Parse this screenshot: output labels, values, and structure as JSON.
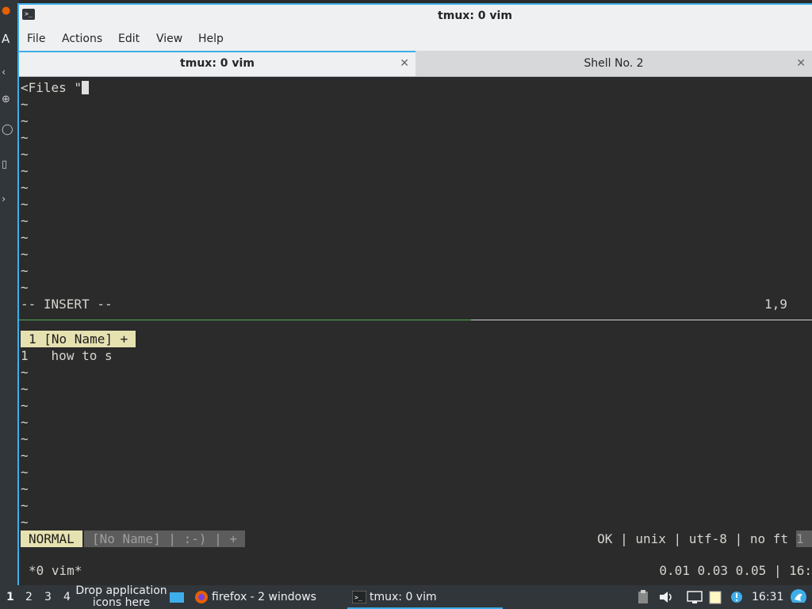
{
  "window": {
    "title": "tmux: 0 vim",
    "menu": [
      "File",
      "Actions",
      "Edit",
      "View",
      "Help"
    ]
  },
  "tabs": [
    {
      "label": "tmux: 0 vim",
      "active": true
    },
    {
      "label": "Shell No. 2",
      "active": false
    }
  ],
  "top_pane": {
    "first_line": "<Files \"",
    "tilde": "~",
    "mode_line": "-- INSERT --",
    "cursor_pos": "1,9"
  },
  "bottom_pane": {
    "tabline": "1 [No Name] +",
    "line_number": "1",
    "line_text": "how to s",
    "tilde": "~",
    "status": {
      "mode": "NORMAL",
      "middle": "[No Name] | :-) | +",
      "right": "OK | unix | utf-8 | no ft",
      "end": "1"
    }
  },
  "tmux": {
    "left": "*0 vim*",
    "right": "0.01 0.03 0.05 | 16:"
  },
  "taskbar": {
    "workspaces": [
      "1",
      "2",
      "3",
      "4"
    ],
    "drop_text": "Drop application icons here",
    "tasks": [
      "firefox - 2 windows",
      "tmux: 0 vim"
    ],
    "clock": "16:31"
  },
  "desktop_strip": {
    "letter": "A"
  },
  "colors": {
    "accent": "#3daee9",
    "terminal_bg": "#2b2b2b",
    "statusline_mode": "#e6e1b0"
  }
}
